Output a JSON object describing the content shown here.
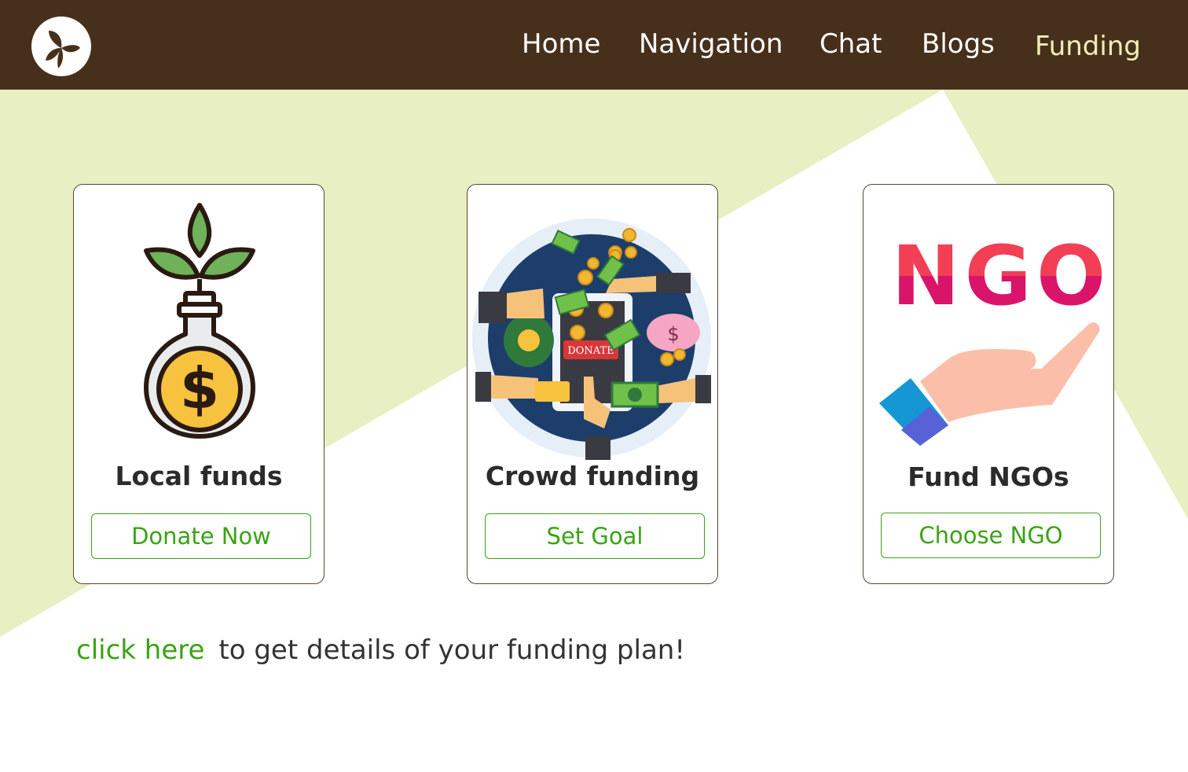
{
  "nav": {
    "items": [
      "Home",
      "Navigation",
      "Chat",
      "Blogs",
      "Funding"
    ],
    "active": "Funding"
  },
  "cards": [
    {
      "title": "Local funds",
      "button": "Donate Now",
      "art": "plant-coin-bulb-icon"
    },
    {
      "title": "Crowd funding",
      "button": "Set Goal",
      "art": "crowdfunding-illustration",
      "art_label": "DONATE"
    },
    {
      "title": "Fund NGOs",
      "button": "Choose NGO",
      "art": "ngo-hand-icon",
      "art_label": "NGO"
    }
  ],
  "footer": {
    "link": "click here",
    "text": "to get details of your funding plan!"
  },
  "colors": {
    "header_bg": "#47301b",
    "nav_active": "#f0edb8",
    "accent_green": "#3aa315",
    "bg_shape": "#e8efc2"
  }
}
